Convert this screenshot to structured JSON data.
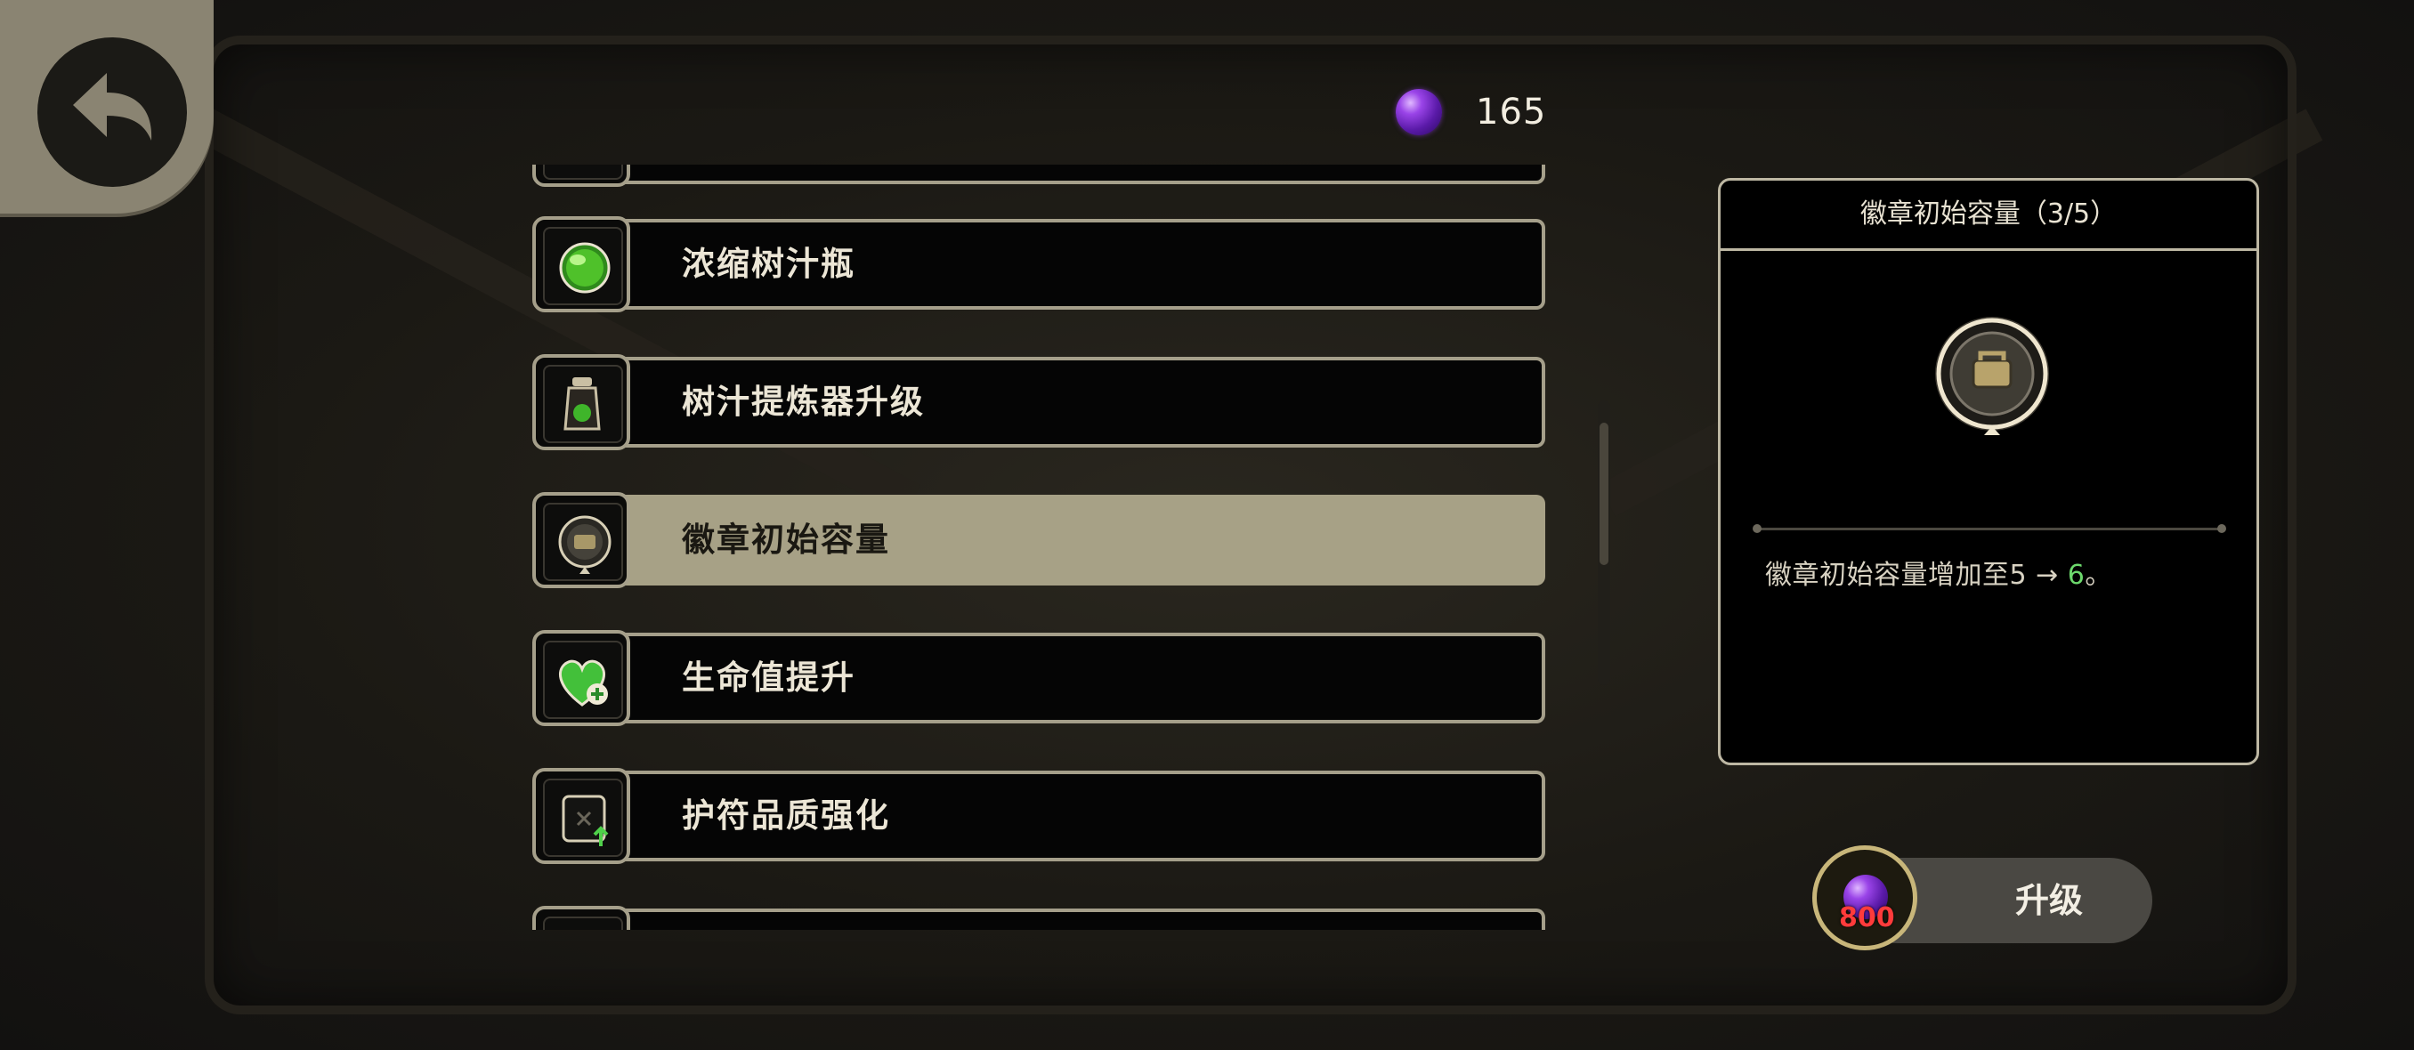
{
  "currency": {
    "icon": "purple-orb-icon",
    "count": "165"
  },
  "upgrades": [
    {
      "label": "",
      "icon": "partial-icon"
    },
    {
      "label": "浓缩树汁瓶",
      "icon": "green-gem-icon"
    },
    {
      "label": "树汁提炼器升级",
      "icon": "sap-extractor-icon"
    },
    {
      "label": "徽章初始容量",
      "icon": "badge-capacity-icon",
      "selected": true
    },
    {
      "label": "生命值提升",
      "icon": "green-heart-plus-icon"
    },
    {
      "label": "护符品质强化",
      "icon": "charm-upgrade-icon"
    },
    {
      "label": "",
      "icon": "partial-icon"
    }
  ],
  "detail": {
    "title": "徽章初始容量（3/5）",
    "icon": "badge-capacity-icon",
    "desc_prefix": "徽章初始容量增加至5 → ",
    "desc_value": "6",
    "desc_suffix": "。"
  },
  "upgrade_button": {
    "label": "升级",
    "cost": "800"
  },
  "colors": {
    "accent_highlight": "#a7a186",
    "value_green": "#6cd86c",
    "cost_red": "#ff3b3b",
    "panel_border": "#bdb7a3"
  }
}
